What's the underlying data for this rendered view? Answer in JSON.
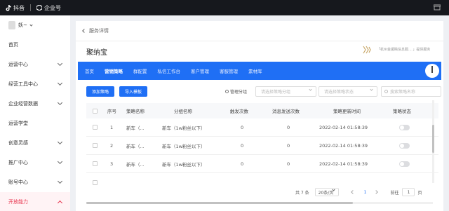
{
  "topbar": {
    "douyin": "抖音",
    "qiye": "企业号"
  },
  "sidebar": {
    "user": "妖~",
    "items": [
      {
        "label": "首页",
        "has_arrow": false
      },
      {
        "label": "运营中心",
        "has_arrow": true
      },
      {
        "label": "经营工具中心",
        "has_arrow": true
      },
      {
        "label": "企业经营数据",
        "has_arrow": true
      },
      {
        "label": "运营学堂",
        "has_arrow": false
      },
      {
        "label": "创意灵感",
        "has_arrow": true
      },
      {
        "label": "推广中心",
        "has_arrow": true
      },
      {
        "label": "账号中心",
        "has_arrow": true
      },
      {
        "label": "开放能力",
        "has_arrow": true,
        "active": true
      }
    ]
  },
  "breadcrumb": {
    "label": "服务详情"
  },
  "app": {
    "title": "聚纳宝",
    "company": "「杭州金媚睛信息服... 」提供服务"
  },
  "tabs": [
    "首页",
    "营销策略",
    "群配置",
    "私信工作台",
    "客户管理",
    "客服管理",
    "素材库"
  ],
  "toolbar": {
    "add_label": "添加策略",
    "import_label": "导入模板",
    "manage_label": "管理分组",
    "group_placeholder": "请选择策略分组",
    "status_placeholder": "请选择策略状态",
    "search_placeholder": "搜索策略名称"
  },
  "table": {
    "headers": [
      "序号",
      "策略名称",
      "分组名称",
      "触发次数",
      "消息发送次数",
      "策略更新时间",
      "策略状态"
    ],
    "rows": [
      {
        "index": "1",
        "name": "新车（...",
        "group": "新车（1w粉丝以下）",
        "triggers": "0",
        "sends": "0",
        "updated": "2022-02-14 01:58:39",
        "status_on": false
      },
      {
        "index": "2",
        "name": "新车（...",
        "group": "新车（1w粉丝以下）",
        "triggers": "0",
        "sends": "0",
        "updated": "2022-02-14 01:58:39",
        "status_on": false
      },
      {
        "index": "3",
        "name": "新车（...",
        "group": "新车（1w粉丝以下）",
        "triggers": "0",
        "sends": "0",
        "updated": "2022-02-14 01:58:39",
        "status_on": false
      }
    ]
  },
  "pagination": {
    "total": "共 7 条",
    "page_size": "20条/页",
    "current": "1",
    "goto_label": "前往",
    "goto_value": "1",
    "page_suffix": "页"
  },
  "colors": {
    "primary": "#1f6ff5",
    "active_nav": "#e8344e",
    "topbar": "#16181d"
  }
}
